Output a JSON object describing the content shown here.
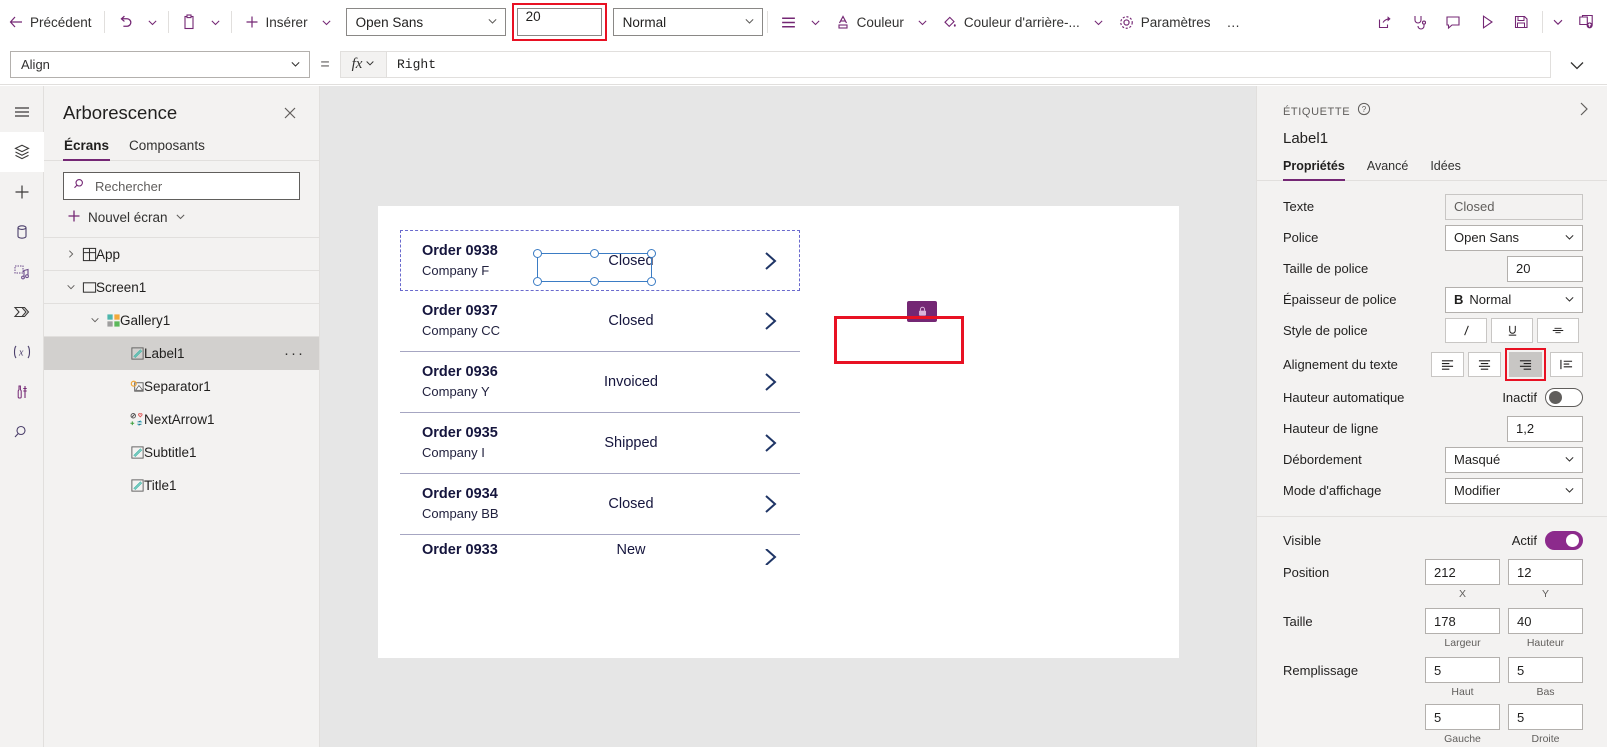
{
  "toolbar": {
    "back_label": "Précédent",
    "undo_icon": "undo-icon",
    "paste_icon": "clipboard-icon",
    "insert_label": "Insérer",
    "font_value": "Open Sans",
    "font_size_value": "20",
    "font_weight_value": "Normal",
    "align_icon": "align-icon",
    "color_label": "Couleur",
    "fill_label": "Couleur d'arrière-...",
    "settings_label": "Paramètres",
    "overflow_label": "…",
    "right_icons": [
      {
        "name": "share-icon",
        "glyph": "share"
      },
      {
        "name": "app-checker-icon",
        "glyph": "stethoscope"
      },
      {
        "name": "comments-icon",
        "glyph": "comment"
      },
      {
        "name": "preview-play-icon",
        "glyph": "play"
      },
      {
        "name": "save-icon",
        "glyph": "save"
      },
      {
        "name": "save-options-caret-icon",
        "glyph": "caret"
      },
      {
        "name": "publish-icon",
        "glyph": "publish"
      }
    ]
  },
  "formula_bar": {
    "property_value": "Align",
    "equals": "=",
    "fx_label": "fx",
    "formula_value": "Right"
  },
  "rail": {
    "items": [
      {
        "name": "hamburger-menu-icon",
        "active": false
      },
      {
        "name": "tree-view-icon",
        "active": true
      },
      {
        "name": "insert-plus-icon",
        "active": false
      },
      {
        "name": "data-cylinder-icon",
        "active": false
      },
      {
        "name": "media-icon",
        "active": false
      },
      {
        "name": "power-automate-icon",
        "active": false
      },
      {
        "name": "variables-icon",
        "active": false
      },
      {
        "name": "experimental-tools-icon",
        "active": false
      },
      {
        "name": "search-icon",
        "active": false
      }
    ]
  },
  "tree_panel": {
    "title": "Arborescence",
    "close_icon": "close-icon",
    "tabs": [
      {
        "label": "Écrans",
        "selected": true
      },
      {
        "label": "Composants",
        "selected": false
      }
    ],
    "search_placeholder": "Rechercher",
    "new_screen_label": "Nouvel écran",
    "rows": [
      {
        "label": "App",
        "icon": "app-icon",
        "chevron": "right",
        "indent": 0,
        "selected": false,
        "divider": true
      },
      {
        "label": "Screen1",
        "icon": "screen-icon",
        "chevron": "down",
        "indent": 0,
        "selected": false,
        "divider": true
      },
      {
        "label": "Gallery1",
        "icon": "gallery-icon",
        "chevron": "down",
        "indent": 1,
        "selected": false,
        "divider": true
      },
      {
        "label": "Label1",
        "icon": "label-icon",
        "chevron": "",
        "indent": 2,
        "selected": true,
        "divider": false,
        "dots": "···"
      },
      {
        "label": "Separator1",
        "icon": "separator-icon",
        "chevron": "",
        "indent": 2,
        "selected": false,
        "divider": false
      },
      {
        "label": "NextArrow1",
        "icon": "next-arrow-icon",
        "chevron": "",
        "indent": 2,
        "selected": false,
        "divider": false
      },
      {
        "label": "Subtitle1",
        "icon": "label-icon",
        "chevron": "",
        "indent": 2,
        "selected": false,
        "divider": false
      },
      {
        "label": "Title1",
        "icon": "label-icon",
        "chevron": "",
        "indent": 2,
        "selected": false,
        "divider": false
      }
    ]
  },
  "canvas": {
    "gallery_items": [
      {
        "title": "Order 0938",
        "subtitle": "Company F",
        "status": "Closed",
        "arrow": "chevron-right-icon"
      },
      {
        "title": "Order 0937",
        "subtitle": "Company CC",
        "status": "Closed",
        "arrow": "chevron-right-icon"
      },
      {
        "title": "Order 0936",
        "subtitle": "Company Y",
        "status": "Invoiced",
        "arrow": "chevron-right-icon"
      },
      {
        "title": "Order 0935",
        "subtitle": "Company I",
        "status": "Shipped",
        "arrow": "chevron-right-icon"
      },
      {
        "title": "Order 0934",
        "subtitle": "Company BB",
        "status": "Closed",
        "arrow": "chevron-right-icon"
      },
      {
        "title": "Order 0933",
        "subtitle": "",
        "status": "New",
        "arrow": "chevron-right-icon"
      }
    ]
  },
  "properties": {
    "kind": "ÉTIQUETTE",
    "help_icon": "help-circle-icon",
    "collapse_icon": "chevron-right-icon",
    "control_name": "Label1",
    "tabs": [
      {
        "label": "Propriétés",
        "selected": true
      },
      {
        "label": "Avancé",
        "selected": false
      },
      {
        "label": "Idées",
        "selected": false
      }
    ],
    "fields": {
      "text_label": "Texte",
      "text_value": "Closed",
      "font_label": "Police",
      "font_value": "Open Sans",
      "font_size_label": "Taille de police",
      "font_size_value": "20",
      "font_weight_label": "Épaisseur de police",
      "font_weight_value": "Normal",
      "font_weight_prefix": "B",
      "font_style_label": "Style de police",
      "font_style_italic": "I",
      "font_style_underline": "U",
      "font_style_strike": "S",
      "text_align_label": "Alignement du texte",
      "align_left": "align-left-icon",
      "align_center": "align-center-icon",
      "align_right": "align-right-icon",
      "align_justify": "align-justify-icon",
      "auto_height_label": "Hauteur automatique",
      "auto_height_state": "Inactif",
      "line_height_label": "Hauteur de ligne",
      "line_height_value": "1,2",
      "overflow_label": "Débordement",
      "overflow_value": "Masqué",
      "display_mode_label": "Mode d'affichage",
      "display_mode_value": "Modifier",
      "visible_label": "Visible",
      "visible_state": "Actif",
      "position_label": "Position",
      "position_x": "212",
      "position_y": "12",
      "position_x_cap": "X",
      "position_y_cap": "Y",
      "size_label": "Taille",
      "size_w": "178",
      "size_h": "40",
      "size_w_cap": "Largeur",
      "size_h_cap": "Hauteur",
      "padding_label": "Remplissage",
      "padding_top": "5",
      "padding_bottom": "5",
      "padding_left": "5",
      "padding_right": "5",
      "padding_top_cap": "Haut",
      "padding_bottom_cap": "Bas",
      "padding_left_cap": "Gauche",
      "padding_right_cap": "Droite"
    }
  },
  "colors": {
    "accent": "#742774",
    "highlight_red": "#e81123",
    "panel_bg": "#f3f2f1",
    "canvas_bg": "#e6e6e6",
    "selection_blue": "#3b7cc4",
    "gallery_text": "#15153d"
  }
}
